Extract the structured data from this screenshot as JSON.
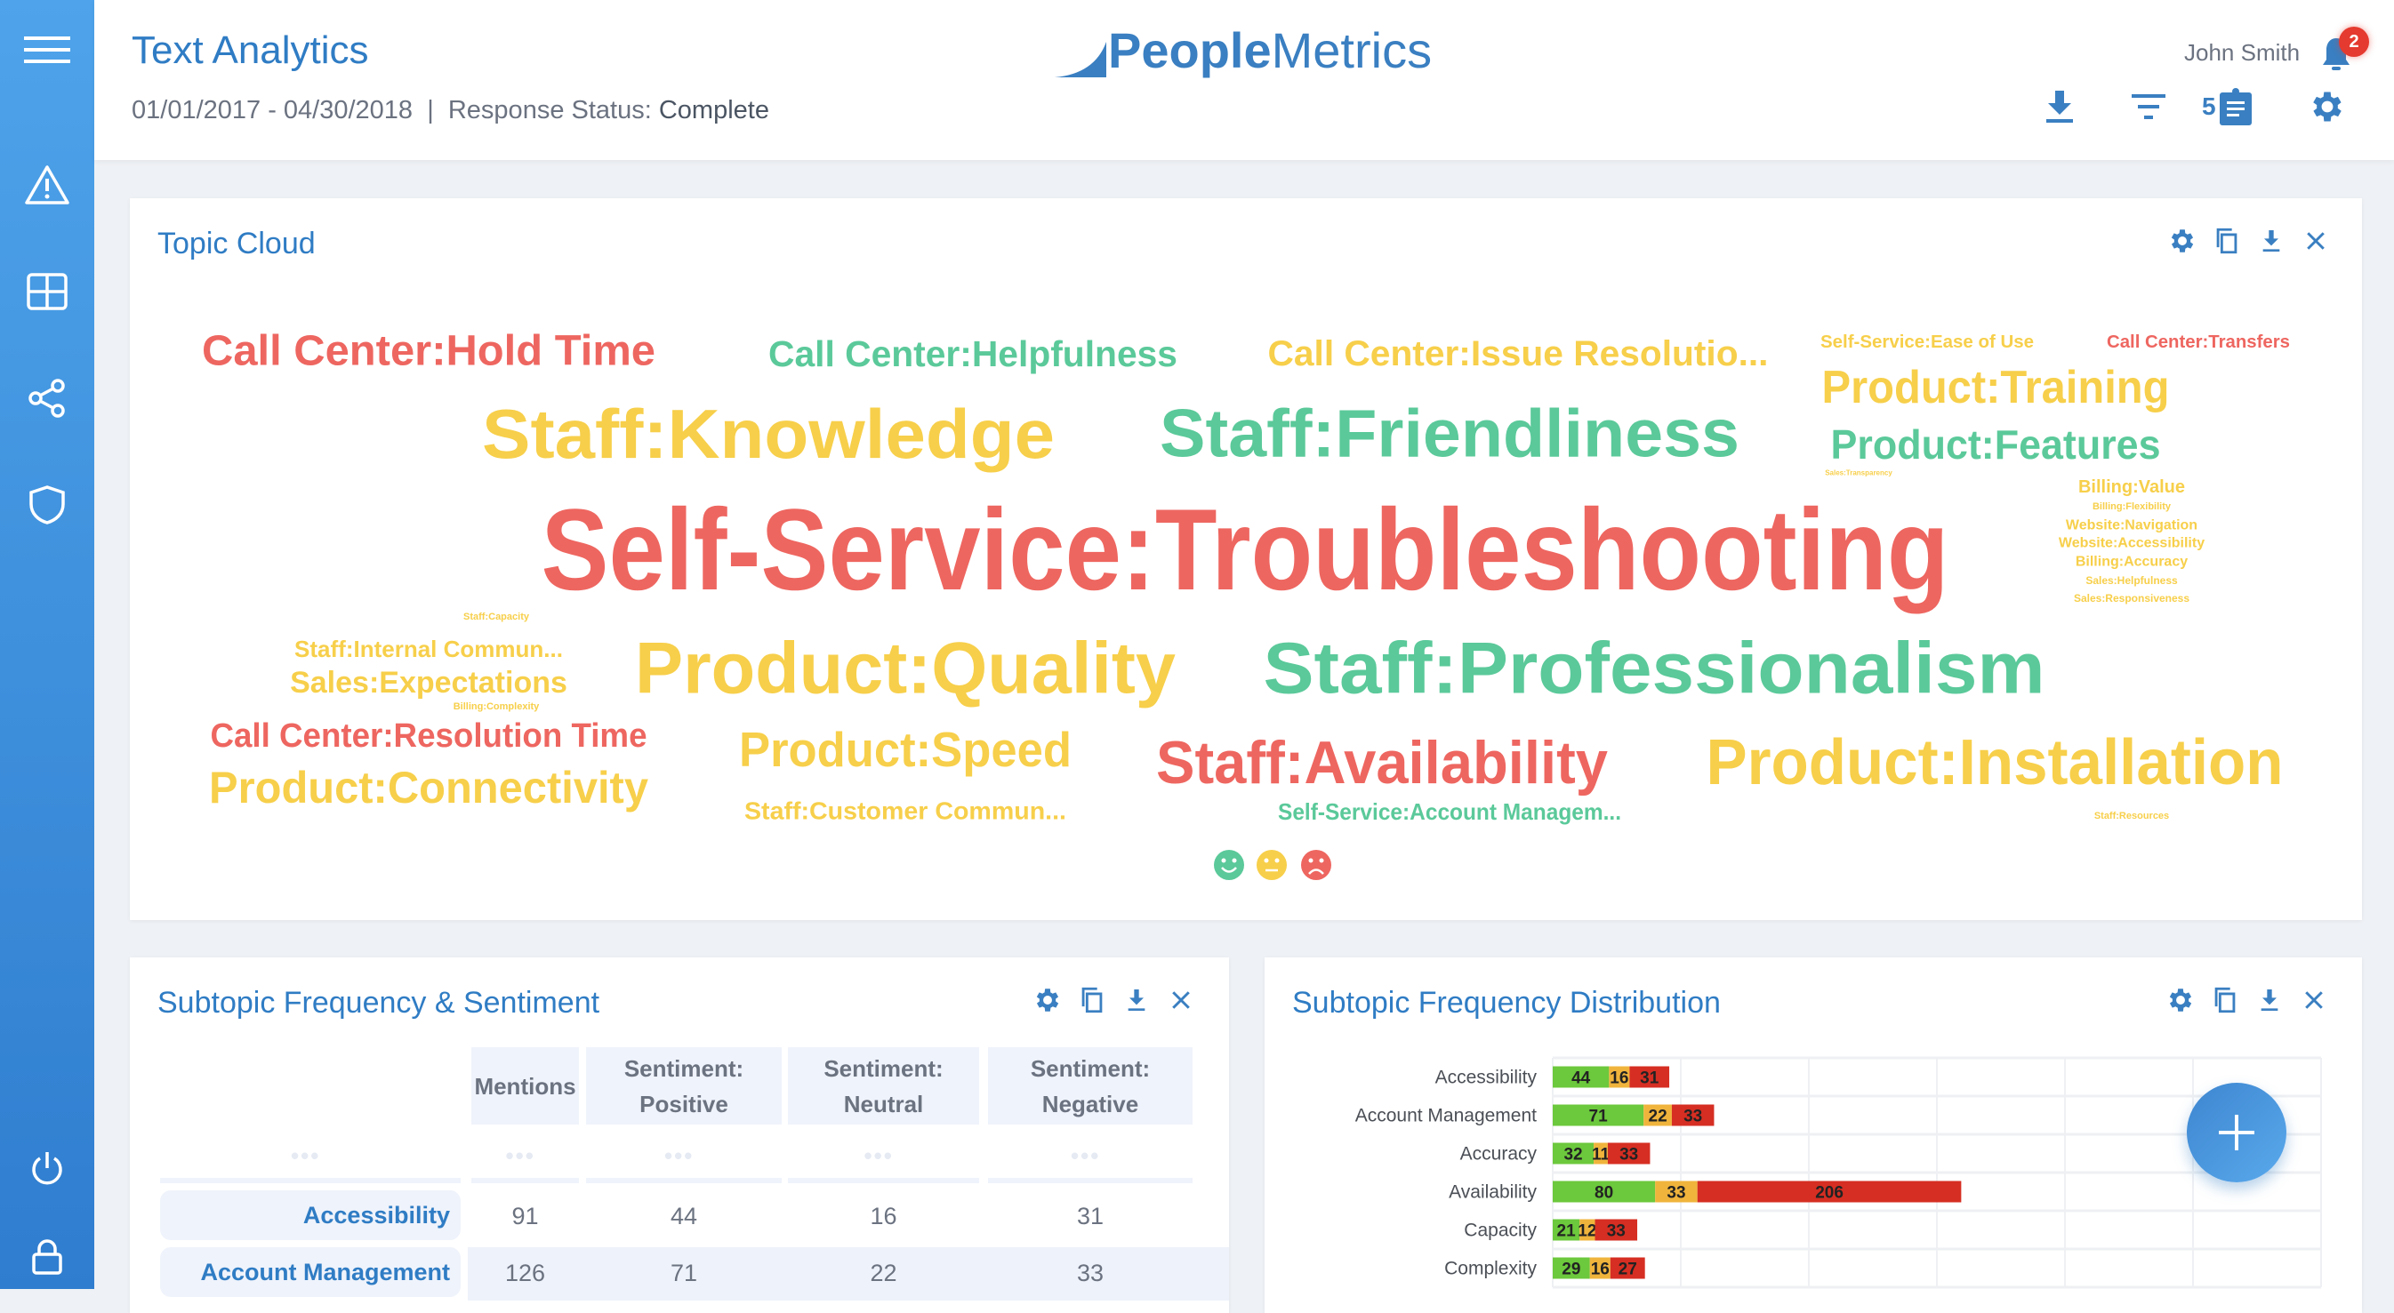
{
  "sidebar": {
    "icons": [
      "menu-icon",
      "alert-icon",
      "grid-icon",
      "share-icon",
      "shield-icon",
      "power-icon",
      "lock-icon"
    ]
  },
  "header": {
    "title": "Text Analytics",
    "date_range": "01/01/2017 - 04/30/2018",
    "separator": "|",
    "status_label": "Response Status:",
    "status_value": "Complete",
    "logo": {
      "bold": "People",
      "light": "Metrics"
    },
    "user": "John Smith",
    "notifications": "2",
    "clipboard_count": "5"
  },
  "colors": {
    "accent": "#2f7cc4",
    "negative": "#ee6660",
    "positive": "#5bc99a",
    "neutral": "#f7cf4a",
    "bar_positive": "#6cc83c",
    "bar_neutral": "#f0b43c",
    "bar_negative": "#d62e22"
  },
  "topic_cloud": {
    "title": "Topic Cloud",
    "words": [
      {
        "text": "Call Center:Hold Time",
        "sentiment": "negative"
      },
      {
        "text": "Call Center:Helpfulness",
        "sentiment": "positive"
      },
      {
        "text": "Call Center:Issue Resolutio...",
        "sentiment": "neutral"
      },
      {
        "text": "Self-Service:Ease of Use",
        "sentiment": "neutral"
      },
      {
        "text": "Call Center:Transfers",
        "sentiment": "negative"
      },
      {
        "text": "Staff:Knowledge",
        "sentiment": "neutral"
      },
      {
        "text": "Staff:Friendliness",
        "sentiment": "positive"
      },
      {
        "text": "Product:Training",
        "sentiment": "neutral"
      },
      {
        "text": "Product:Features",
        "sentiment": "positive"
      },
      {
        "text": "Sales:Transparency",
        "sentiment": "neutral"
      },
      {
        "text": "Self-Service:Troubleshooting",
        "sentiment": "negative"
      },
      {
        "text": "Billing:Value",
        "sentiment": "neutral"
      },
      {
        "text": "Billing:Flexibility",
        "sentiment": "neutral"
      },
      {
        "text": "Website:Navigation",
        "sentiment": "neutral"
      },
      {
        "text": "Website:Accessibility",
        "sentiment": "neutral"
      },
      {
        "text": "Billing:Accuracy",
        "sentiment": "neutral"
      },
      {
        "text": "Sales:Helpfulness",
        "sentiment": "neutral"
      },
      {
        "text": "Sales:Responsiveness",
        "sentiment": "neutral"
      },
      {
        "text": "Staff:Capacity",
        "sentiment": "neutral"
      },
      {
        "text": "Staff:Internal Commun...",
        "sentiment": "neutral"
      },
      {
        "text": "Sales:Expectations",
        "sentiment": "neutral"
      },
      {
        "text": "Billing:Complexity",
        "sentiment": "neutral"
      },
      {
        "text": "Call Center:Resolution Time",
        "sentiment": "negative"
      },
      {
        "text": "Product:Connectivity",
        "sentiment": "neutral"
      },
      {
        "text": "Product:Quality",
        "sentiment": "neutral"
      },
      {
        "text": "Staff:Professionalism",
        "sentiment": "positive"
      },
      {
        "text": "Product:Speed",
        "sentiment": "neutral"
      },
      {
        "text": "Staff:Customer Commun...",
        "sentiment": "neutral"
      },
      {
        "text": "Staff:Availability",
        "sentiment": "negative"
      },
      {
        "text": "Self-Service:Account Managem...",
        "sentiment": "positive"
      },
      {
        "text": "Product:Installation",
        "sentiment": "neutral"
      },
      {
        "text": "Staff:Resources",
        "sentiment": "neutral"
      }
    ],
    "legend": [
      "positive",
      "neutral",
      "negative"
    ]
  },
  "sentiment_table": {
    "title": "Subtopic Frequency & Sentiment",
    "columns": [
      {
        "l1": "Mentions",
        "l2": ""
      },
      {
        "l1": "Sentiment:",
        "l2": "Positive"
      },
      {
        "l1": "Sentiment:",
        "l2": "Neutral"
      },
      {
        "l1": "Sentiment:",
        "l2": "Negative"
      }
    ],
    "placeholder": "•••",
    "rows": [
      {
        "label": "Accessibility",
        "values": [
          "91",
          "44",
          "16",
          "31"
        ]
      },
      {
        "label": "Account Management",
        "values": [
          "126",
          "71",
          "22",
          "33"
        ]
      }
    ]
  },
  "distribution": {
    "title": "Subtopic Frequency Distribution"
  },
  "chart_data": {
    "type": "bar",
    "stacked": true,
    "orientation": "horizontal",
    "xlim": [
      0,
      600
    ],
    "grid": true,
    "categories": [
      "Accessibility",
      "Account Management",
      "Accuracy",
      "Availability",
      "Capacity",
      "Complexity"
    ],
    "series": [
      {
        "key": "positive",
        "values": [
          44,
          71,
          32,
          80,
          21,
          29
        ]
      },
      {
        "key": "neutral",
        "values": [
          16,
          22,
          11,
          33,
          12,
          16
        ]
      },
      {
        "key": "negative",
        "values": [
          31,
          33,
          33,
          206,
          33,
          27
        ]
      }
    ]
  },
  "fab": {
    "icon": "plus-icon"
  }
}
